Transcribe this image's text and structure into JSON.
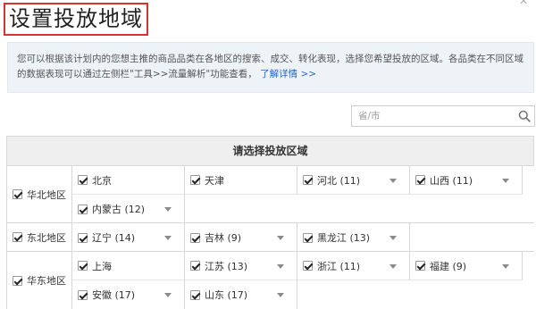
{
  "dialog": {
    "title": "设置投放地域",
    "close_glyph": "×"
  },
  "notice": {
    "text": "您可以根据该计划内的您想主推的商品品类在各地区的搜索、成交、转化表现，选择您希望投放的区域。各品类在不同区域的数据表现可以通过左侧栏\"工具>>流量解析\"功能查看，",
    "link": "了解详情 >>"
  },
  "search": {
    "placeholder": "省/市"
  },
  "grid": {
    "header": "请选择投放区域",
    "regions": [
      {
        "name": "华北地区",
        "checked": true,
        "provinces": [
          {
            "label": "北京",
            "checked": true,
            "dropdown": false
          },
          {
            "label": "天津",
            "checked": true,
            "dropdown": false
          },
          {
            "label": "河北 (11)",
            "checked": true,
            "dropdown": true
          },
          {
            "label": "山西 (11)",
            "checked": true,
            "dropdown": true
          },
          {
            "label": "内蒙古 (12)",
            "checked": true,
            "dropdown": true
          }
        ]
      },
      {
        "name": "东北地区",
        "checked": true,
        "provinces": [
          {
            "label": "辽宁 (14)",
            "checked": true,
            "dropdown": true
          },
          {
            "label": "吉林 (9)",
            "checked": true,
            "dropdown": true
          },
          {
            "label": "黑龙江 (13)",
            "checked": true,
            "dropdown": true
          }
        ]
      },
      {
        "name": "华东地区",
        "checked": true,
        "provinces": [
          {
            "label": "上海",
            "checked": true,
            "dropdown": false
          },
          {
            "label": "江苏 (13)",
            "checked": true,
            "dropdown": true
          },
          {
            "label": "浙江 (11)",
            "checked": true,
            "dropdown": true
          },
          {
            "label": "福建 (9)",
            "checked": true,
            "dropdown": true
          },
          {
            "label": "安徽 (17)",
            "checked": true,
            "dropdown": true
          },
          {
            "label": "山东 (17)",
            "checked": true,
            "dropdown": true
          }
        ]
      }
    ]
  }
}
